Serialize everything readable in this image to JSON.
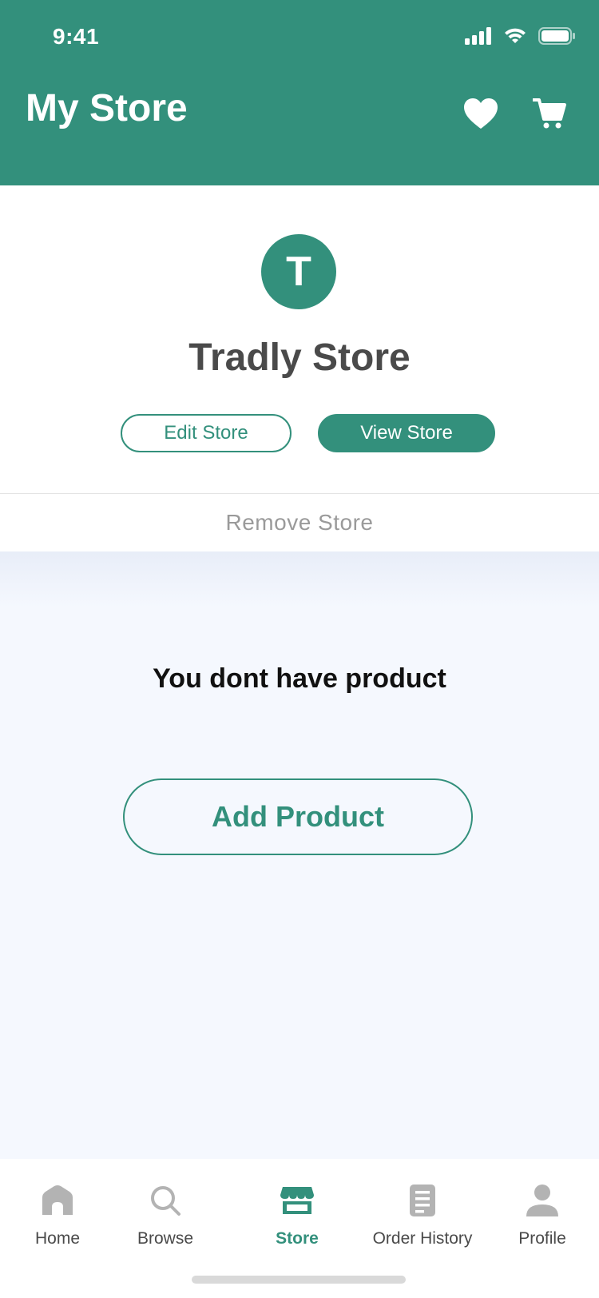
{
  "status_bar": {
    "time": "9:41"
  },
  "header": {
    "title": "My Store"
  },
  "store": {
    "avatar_letter": "T",
    "name": "Tradly Store",
    "edit_label": "Edit Store",
    "view_label": "View Store",
    "remove_label": "Remove  Store"
  },
  "content": {
    "empty_message": "You dont have product",
    "add_label": "Add Product"
  },
  "tabs": [
    {
      "label": "Home",
      "icon": "home-icon"
    },
    {
      "label": "Browse",
      "icon": "search-icon"
    },
    {
      "label": "Store",
      "icon": "store-icon",
      "active": true
    },
    {
      "label": "Order History",
      "icon": "document-icon"
    },
    {
      "label": "Profile",
      "icon": "person-icon"
    }
  ],
  "colors": {
    "accent": "#33907c",
    "inactive_icon": "#b3b3b3",
    "background": "#f5f8fe"
  }
}
